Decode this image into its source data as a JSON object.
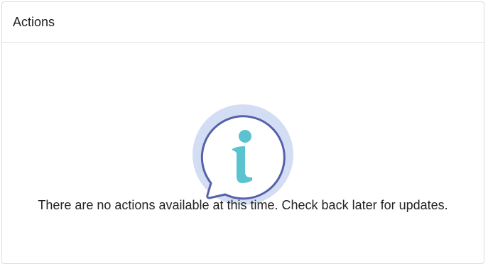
{
  "panel": {
    "title": "Actions"
  },
  "empty_state": {
    "icon": "info-speech-bubble-icon",
    "message": "There are no actions available at this time. Check back later for updates.",
    "colors": {
      "halo": "#d3ddf4",
      "outline": "#5561a9",
      "glyph": "#5bc2cf"
    }
  }
}
